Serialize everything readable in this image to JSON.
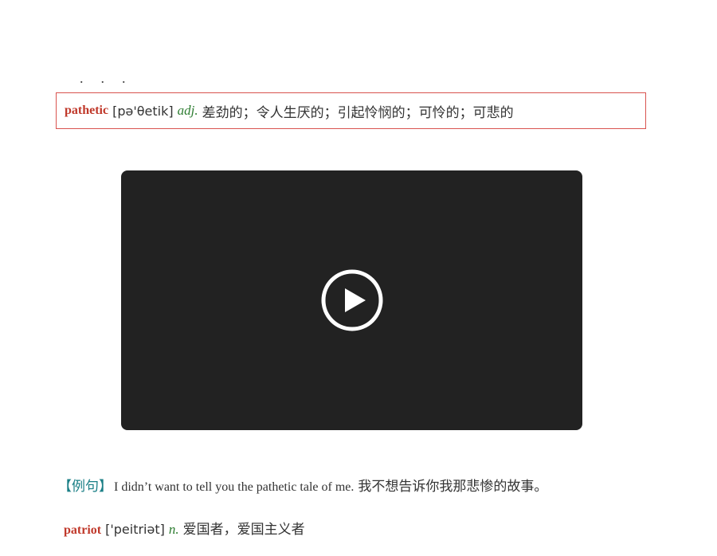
{
  "top_fragment": "...",
  "entry_main": {
    "word": "pathetic",
    "phonetic": "[pə'θetik]",
    "pos": "adj.",
    "definition": "差劲的；令人生厌的；引起怜悯的；可怜的；可悲的"
  },
  "video": {
    "play_icon": "play-icon",
    "background": "#222222"
  },
  "example": {
    "label": "【例句】",
    "english": "I didn’t want to tell you the pathetic tale of me.",
    "chinese": "我不想告诉你我那悲惨的故事。"
  },
  "entry_next": {
    "word": "patriot",
    "phonetic": "['peitriət]",
    "pos": "n.",
    "definition": "爱国者，爱国主义者"
  },
  "colors": {
    "word": "#c0392b",
    "pos": "#2e7d32",
    "label": "#1a7f86",
    "box_border": "#d9534f"
  }
}
